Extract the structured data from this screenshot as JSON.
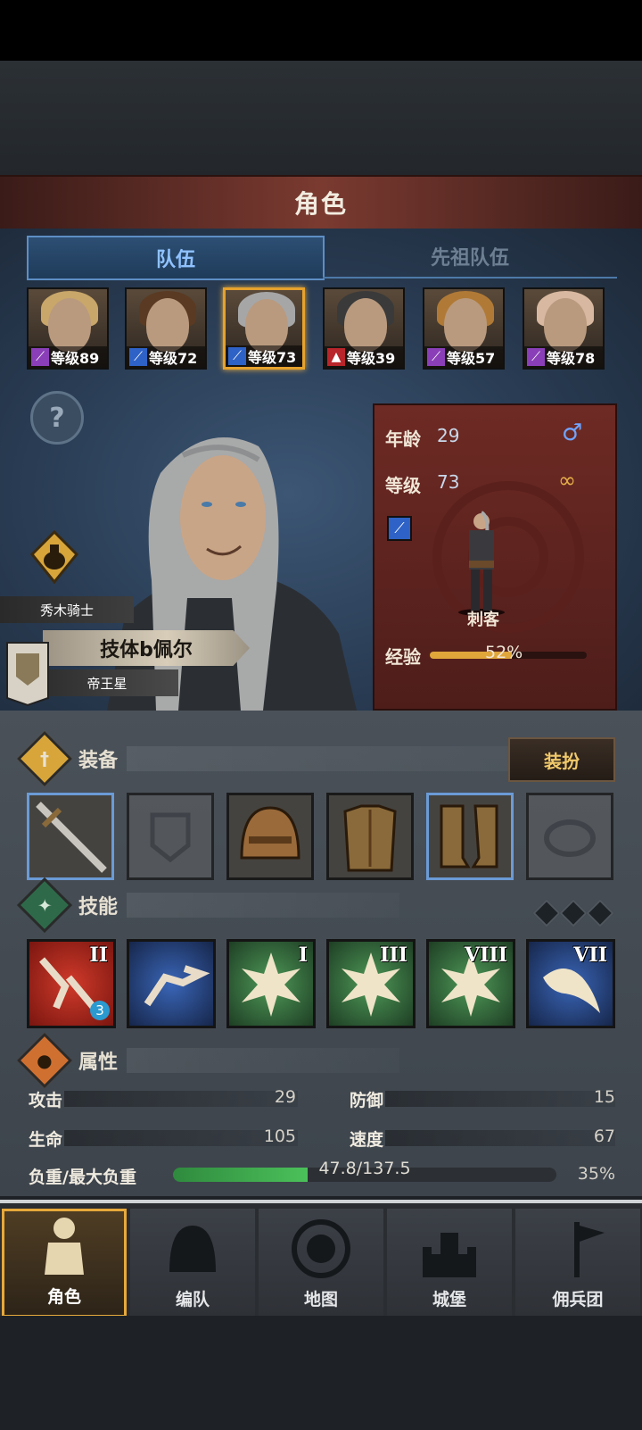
{
  "title": "角色",
  "tabs": {
    "team": "队伍",
    "ancestor_team": "先祖队伍"
  },
  "roster": [
    {
      "level_text": "等级89",
      "class_color": "#8a3fb8",
      "class_icon": "staff-icon",
      "hair": "#c9a76a"
    },
    {
      "level_text": "等级72",
      "class_color": "#2e62c6",
      "class_icon": "dagger-icon",
      "hair": "#5a3a22"
    },
    {
      "level_text": "等级73",
      "class_color": "#2e62c6",
      "class_icon": "dagger-icon",
      "hair": "#a6a6a6"
    },
    {
      "level_text": "等级39",
      "class_color": "#b8252a",
      "class_icon": "beast-icon",
      "hair": "#3a3a3a"
    },
    {
      "level_text": "等级57",
      "class_color": "#8a3fb8",
      "class_icon": "staff-icon",
      "hair": "#b07a36"
    },
    {
      "level_text": "等级78",
      "class_color": "#8a3fb8",
      "class_icon": "staff-icon",
      "hair": "#d8b8a0"
    }
  ],
  "help": "?",
  "hero": {
    "subtitle": "秀木骑士",
    "name": "技体b佩尔",
    "star": "帝王星"
  },
  "info": {
    "age_label": "年龄",
    "age_value": "29",
    "level_label": "等级",
    "level_value": "73",
    "class_name": "刺客",
    "exp_label": "经验",
    "exp_value": "52%",
    "exp_fraction": 0.52
  },
  "equipment": {
    "label": "装备",
    "dress_button": "装扮",
    "slots": [
      "sword",
      "shield",
      "helmet",
      "armor",
      "boots",
      "ring"
    ]
  },
  "skills": {
    "label": "技能",
    "items": [
      {
        "rank": "II",
        "badge": "3",
        "color": "#b4251f"
      },
      {
        "rank": "",
        "badge": "",
        "color": "#2a4d93"
      },
      {
        "rank": "I",
        "badge": "",
        "color": "#3e7a46"
      },
      {
        "rank": "III",
        "badge": "",
        "color": "#3e7a46"
      },
      {
        "rank": "VIII",
        "badge": "",
        "color": "#3e7a46"
      },
      {
        "rank": "VII",
        "badge": "",
        "color": "#2a4d93"
      }
    ]
  },
  "attributes": {
    "label": "属性",
    "attack_label": "攻击",
    "attack_value": "29",
    "defense_label": "防御",
    "defense_value": "15",
    "hp_label": "生命",
    "hp_value": "105",
    "speed_label": "速度",
    "speed_value": "67",
    "load_label": "负重/最大负重",
    "load_value": "47.8/137.5",
    "load_percent": "35%",
    "load_fraction": 0.35
  },
  "nav": [
    {
      "label": "角色",
      "icon": "knight-icon",
      "active": true
    },
    {
      "label": "编队",
      "icon": "helmet-icon",
      "active": false
    },
    {
      "label": "地图",
      "icon": "compass-icon",
      "active": false
    },
    {
      "label": "城堡",
      "icon": "castle-icon",
      "active": false
    },
    {
      "label": "佣兵团",
      "icon": "banner-icon",
      "active": false
    }
  ]
}
